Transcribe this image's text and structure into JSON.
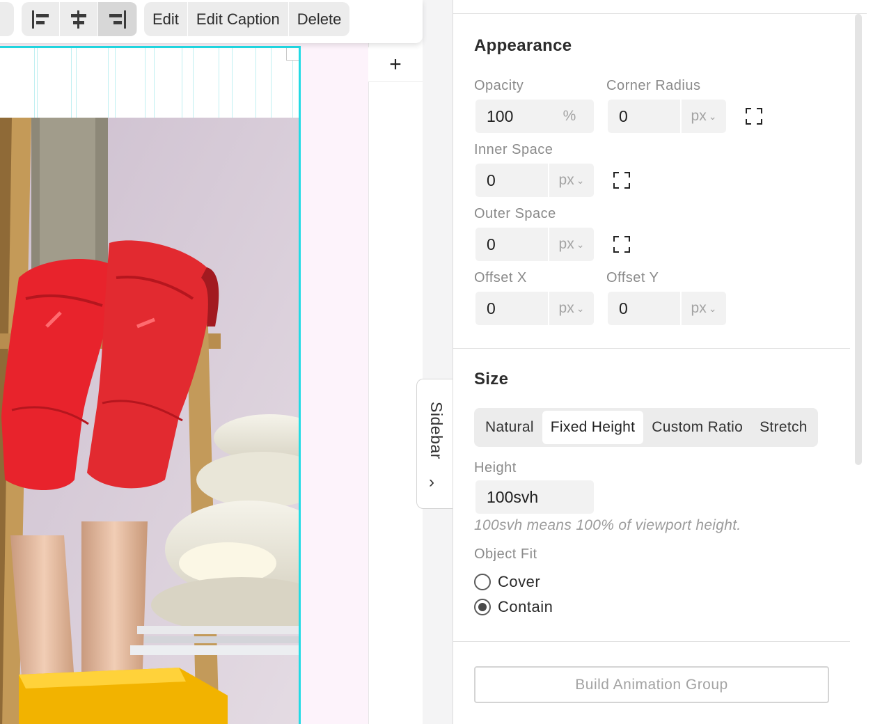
{
  "toolbar": {
    "actions": {
      "edit": "Edit",
      "edit_caption": "Edit Caption",
      "delete": "Delete"
    }
  },
  "canvas": {
    "add_label": "+"
  },
  "sidebar_tab": {
    "label": "Sidebar",
    "chevron": "›"
  },
  "panel": {
    "appearance": {
      "title": "Appearance",
      "opacity": {
        "label": "Opacity",
        "value": "100",
        "unit": "%"
      },
      "corner_radius": {
        "label": "Corner Radius",
        "value": "0",
        "unit": "px"
      },
      "inner_space": {
        "label": "Inner Space",
        "value": "0",
        "unit": "px"
      },
      "outer_space": {
        "label": "Outer Space",
        "value": "0",
        "unit": "px"
      },
      "offset_x": {
        "label": "Offset X",
        "value": "0",
        "unit": "px"
      },
      "offset_y": {
        "label": "Offset Y",
        "value": "0",
        "unit": "px"
      }
    },
    "size": {
      "title": "Size",
      "tabs": [
        "Natural",
        "Fixed Height",
        "Custom Ratio",
        "Stretch"
      ],
      "active_tab": "Fixed Height",
      "height_label": "Height",
      "height_value": "100svh",
      "height_hint": "100svh means 100% of viewport height.",
      "object_fit_label": "Object Fit",
      "object_fit_options": [
        "Cover",
        "Contain"
      ],
      "object_fit_selected": "Contain"
    },
    "build_button": "Build Animation Group"
  },
  "colors": {
    "selection_outline": "#22dbe5",
    "canvas_bg": "#fdf3fb",
    "boots": "#e8232c"
  }
}
